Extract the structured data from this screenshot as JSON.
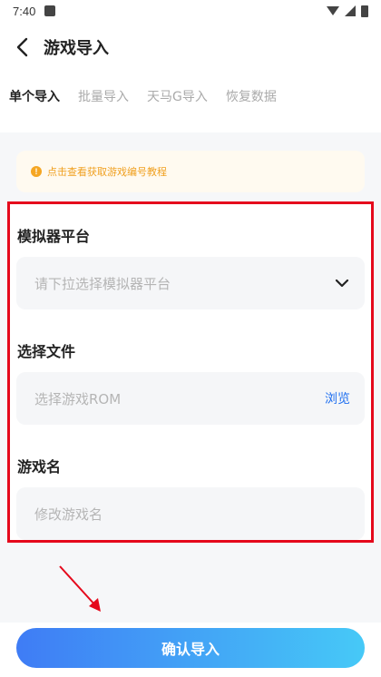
{
  "status_bar": {
    "time": "7:40"
  },
  "header": {
    "title": "游戏导入"
  },
  "tabs": [
    {
      "label": "单个导入",
      "active": true
    },
    {
      "label": "批量导入",
      "active": false
    },
    {
      "label": "天马G导入",
      "active": false
    },
    {
      "label": "恢复数据",
      "active": false
    }
  ],
  "notice": {
    "text": "点击查看获取游戏编号教程"
  },
  "form": {
    "platform": {
      "label": "模拟器平台",
      "placeholder": "请下拉选择模拟器平台"
    },
    "file": {
      "label": "选择文件",
      "placeholder": "选择游戏ROM",
      "action": "浏览"
    },
    "name": {
      "label": "游戏名",
      "placeholder": "修改游戏名"
    }
  },
  "footer": {
    "confirm_label": "确认导入"
  },
  "colors": {
    "accent": "#1e6ff0",
    "highlight_border": "#e5091c",
    "notice_text": "#f0a020"
  }
}
